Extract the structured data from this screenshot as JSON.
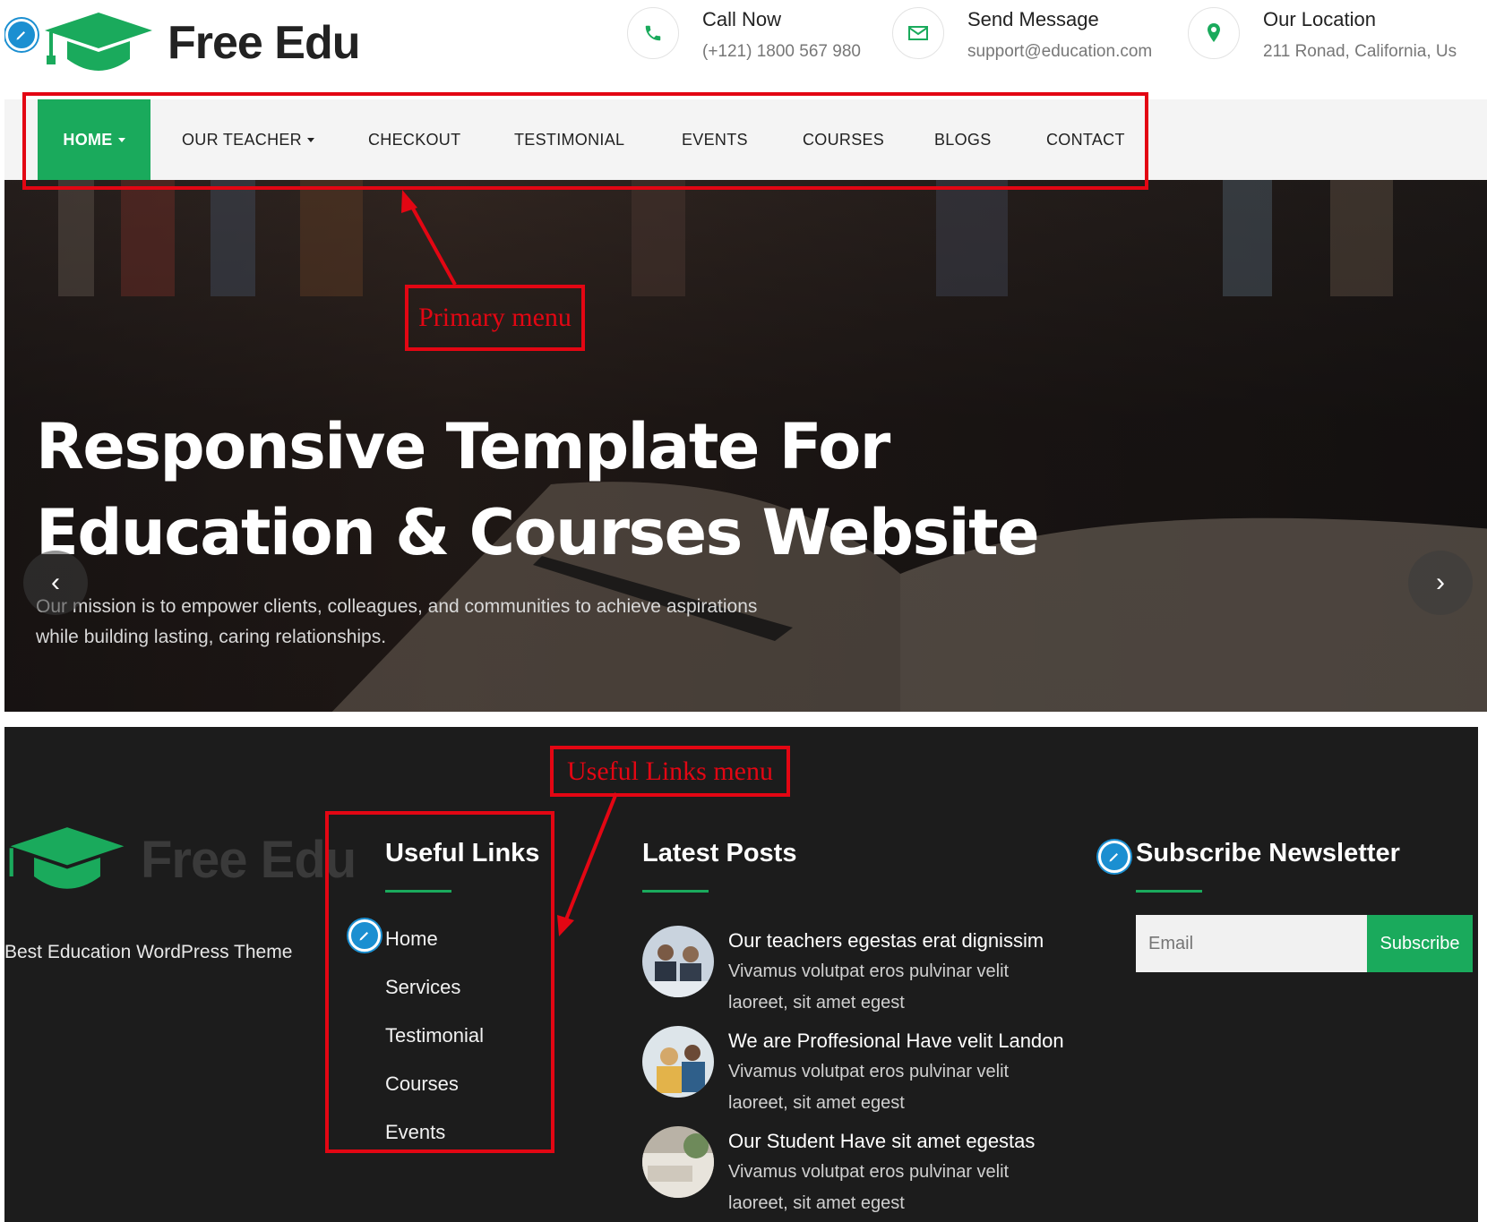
{
  "header": {
    "logo_text": "Free Edu",
    "contacts": [
      {
        "icon": "phone-icon",
        "title": "Call Now",
        "sub": "(+121) 1800 567 980"
      },
      {
        "icon": "envelope-icon",
        "title": "Send Message",
        "sub": "support@education.com"
      },
      {
        "icon": "map-pin-icon",
        "title": "Our Location",
        "sub": "211 Ronad, California, Us"
      }
    ]
  },
  "nav": {
    "items": [
      {
        "label": "HOME",
        "active": true,
        "dropdown": true
      },
      {
        "label": "OUR TEACHER",
        "dropdown": true
      },
      {
        "label": "CHECKOUT"
      },
      {
        "label": "TESTIMONIAL"
      },
      {
        "label": "EVENTS"
      },
      {
        "label": "COURSES"
      },
      {
        "label": "BLOGS"
      },
      {
        "label": "CONTACT"
      }
    ]
  },
  "hero": {
    "title_line1": "Responsive Template For",
    "title_line2": "Education & Courses Website",
    "desc_line1": "Our mission is to empower clients, colleagues, and communities to achieve aspirations",
    "desc_line2": "while building lasting, caring relationships.",
    "prev_icon": "chevron-left-icon",
    "next_icon": "chevron-right-icon"
  },
  "annotations": {
    "primary_menu": "Primary menu",
    "useful_links_menu": "Useful Links menu"
  },
  "footer": {
    "logo_text": "Free Edu",
    "tagline": "Best Education WordPress Theme",
    "useful_links": {
      "heading": "Useful Links",
      "items": [
        "Home",
        "Services",
        "Testimonial",
        "Courses",
        "Events"
      ]
    },
    "latest_posts": {
      "heading": "Latest Posts",
      "posts": [
        {
          "title": "Our teachers egestas erat dignissim",
          "excerpt1": "Vivamus volutpat eros pulvinar velit",
          "excerpt2": "laoreet, sit amet egest"
        },
        {
          "title": "We are Proffesional Have velit Landon",
          "excerpt1": "Vivamus volutpat eros pulvinar velit",
          "excerpt2": "laoreet, sit amet egest"
        },
        {
          "title": "Our Student Have sit amet egestas",
          "excerpt1": "Vivamus volutpat eros pulvinar velit",
          "excerpt2": "laoreet, sit amet egest"
        }
      ]
    },
    "newsletter": {
      "heading": "Subscribe Newsletter",
      "email_placeholder": "Email",
      "button_label": "Subscribe"
    }
  },
  "colors": {
    "brand_green": "#1aaa5c",
    "annotation_red": "#e30613",
    "edit_badge_blue": "#1b8fd1",
    "footer_bg": "#1c1c1c"
  }
}
